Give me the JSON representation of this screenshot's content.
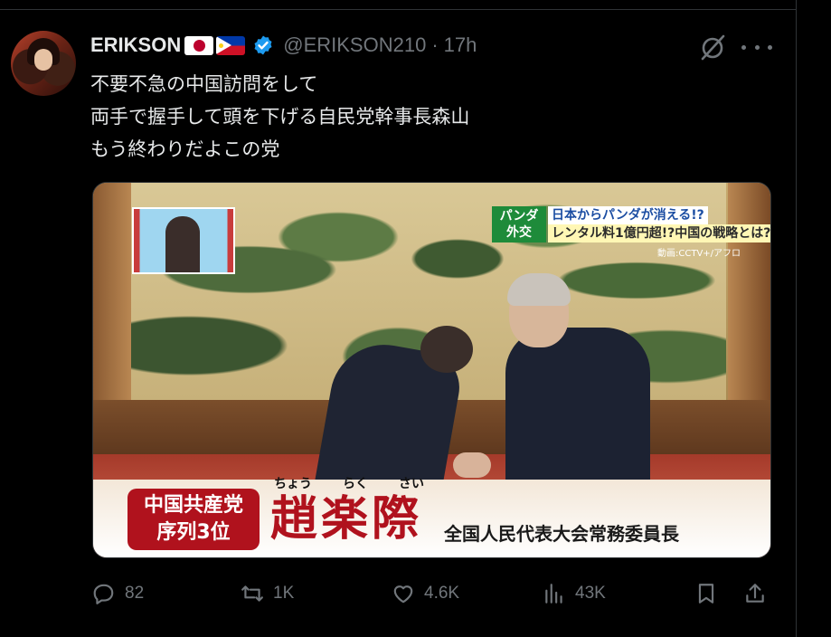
{
  "user": {
    "display_name": "ERIKSON",
    "handle": "@ERIKSON210",
    "separator": "·",
    "time": "17h"
  },
  "tweet": {
    "lines": [
      "不要不急の中国訪問をして",
      "両手で握手して頭を下げる自民党幹事長森山",
      "もう終わりだよこの党"
    ]
  },
  "media": {
    "topic_badge_line1": "パンダ",
    "topic_badge_line2": "外交",
    "topic_title1": "日本からパンダが消える!?",
    "topic_title2": "レンタル料1億円超!?中国の戦略とは?",
    "credit": "動画:CCTV+/アフロ",
    "rank_line1": "中国共産党",
    "rank_line2": "序列3位",
    "furigana": [
      "ちょう",
      "らく",
      "さい"
    ],
    "person_name": "趙楽際",
    "person_title": "全国人民代表大会常務委員長"
  },
  "actions": {
    "reply_count": "82",
    "retweet_count": "1K",
    "like_count": "4.6K",
    "view_count": "43K"
  },
  "colors": {
    "background": "#000000",
    "text": "#e7e9ea",
    "muted": "#71767b",
    "verified": "#1d9bf0"
  }
}
